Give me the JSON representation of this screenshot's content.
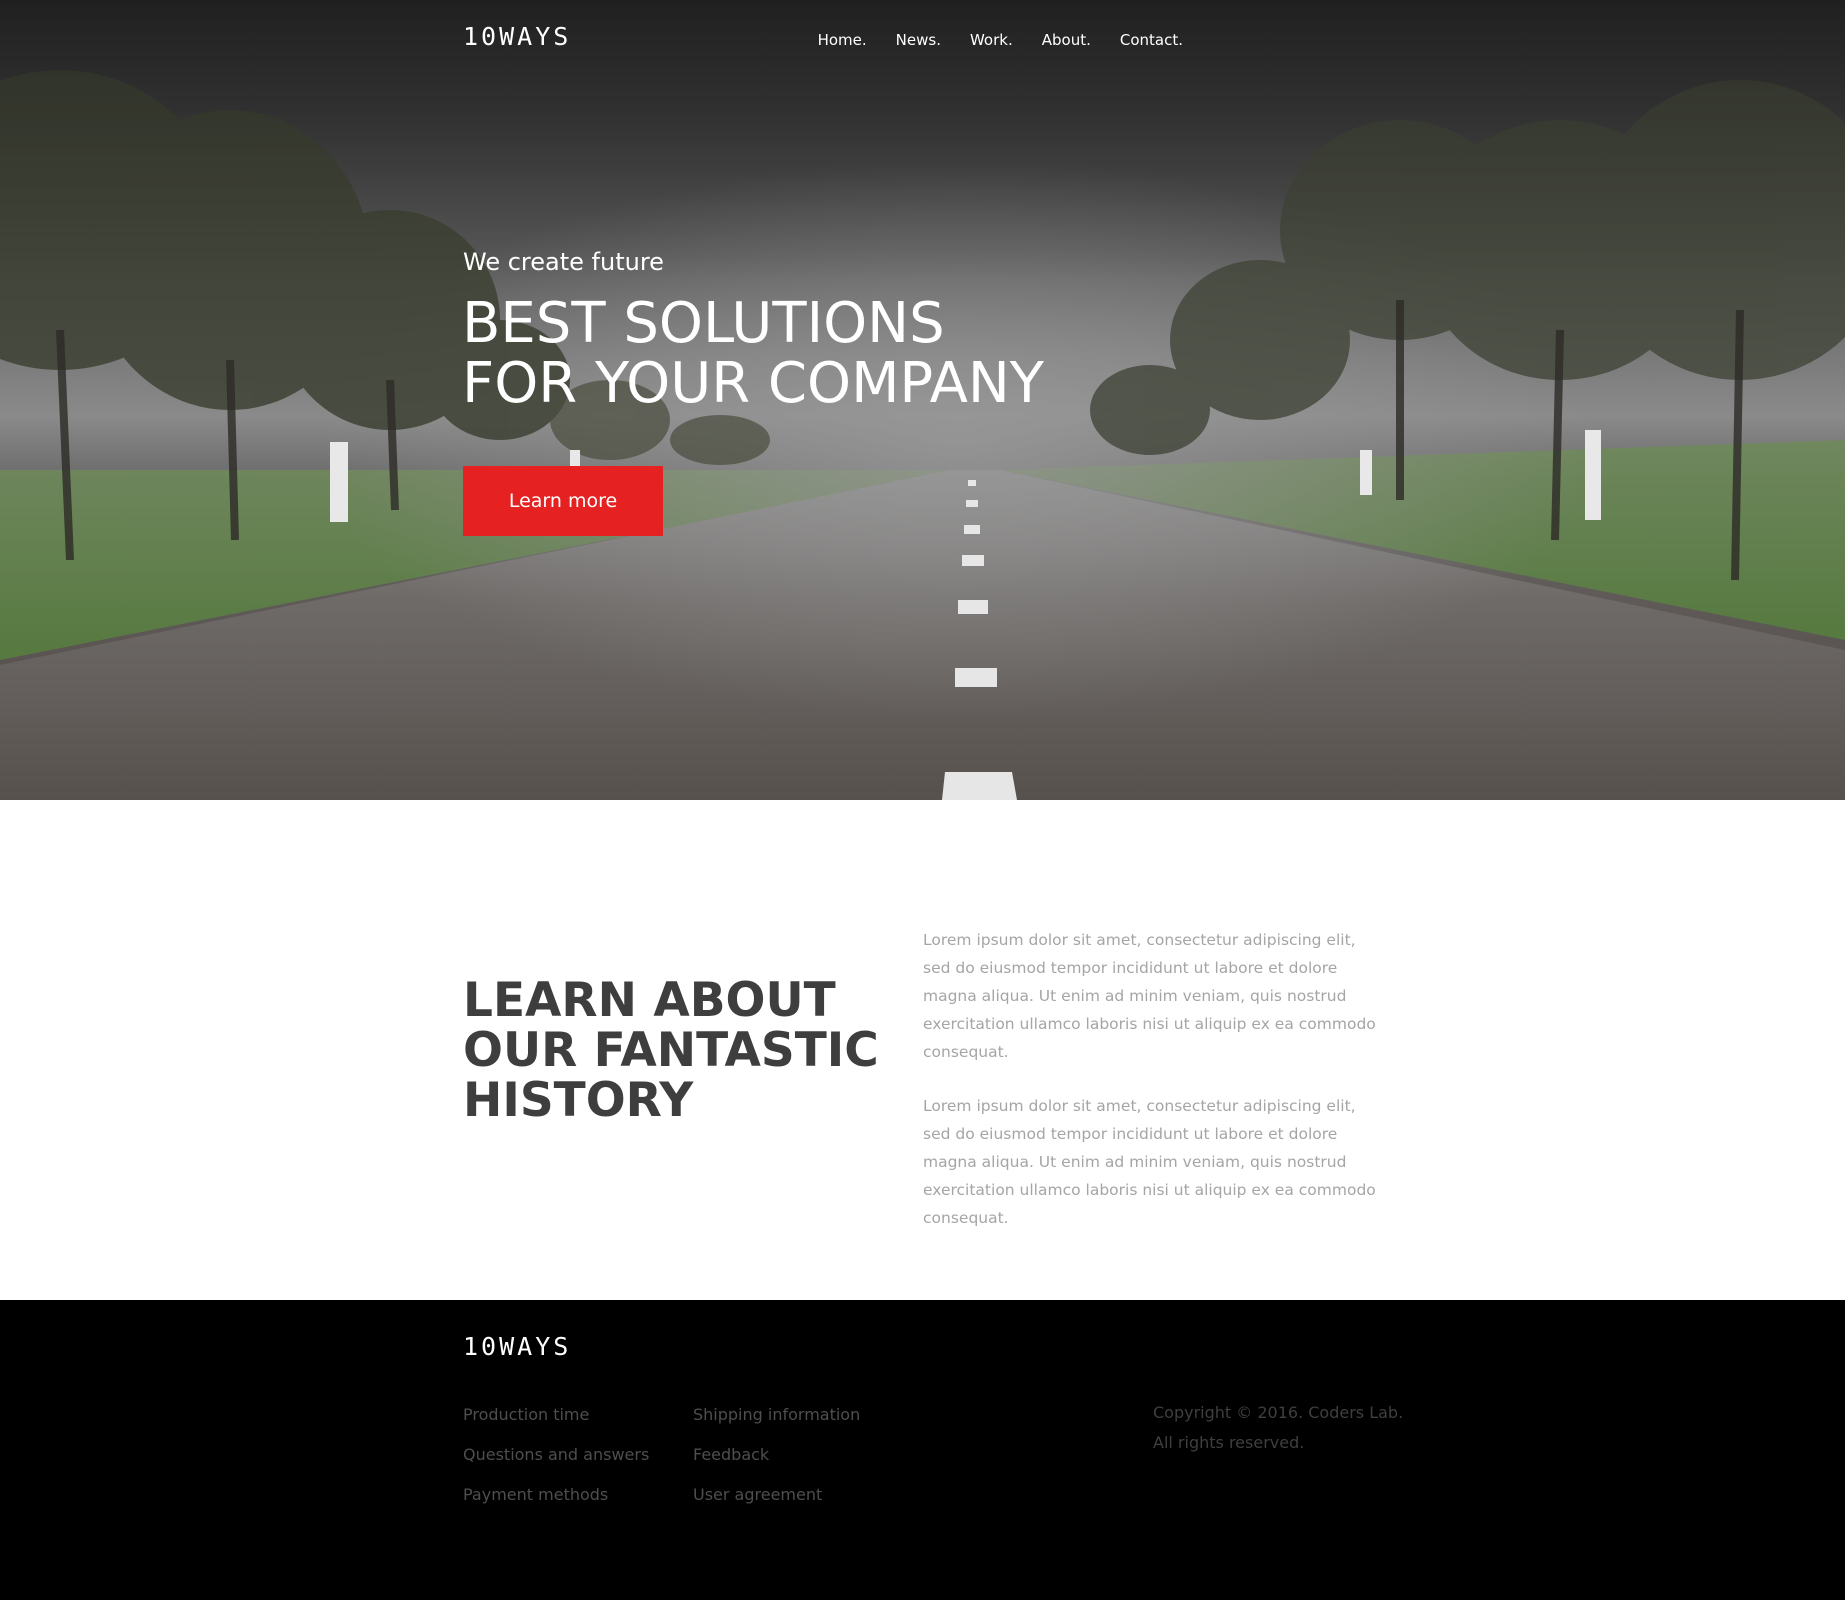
{
  "brand": {
    "logo": "10WAYS"
  },
  "nav": {
    "items": [
      {
        "label": "Home."
      },
      {
        "label": "News."
      },
      {
        "label": "Work."
      },
      {
        "label": "About."
      },
      {
        "label": "Contact."
      }
    ]
  },
  "hero": {
    "subtitle": "We create future",
    "title_line1": "BEST SOLUTIONS",
    "title_line2": "FOR YOUR COMPANY",
    "button_label": "Learn more",
    "button_color": "#e52121"
  },
  "about": {
    "title_line1": "LEARN ABOUT",
    "title_line2": "OUR FANTASTIC",
    "title_line3": "HISTORY",
    "paragraphs": [
      "Lorem ipsum dolor sit amet, consectetur adipiscing elit, sed do eiusmod tempor incididunt ut labore et dolore magna aliqua. Ut enim ad minim veniam, quis nostrud exercitation ullamco laboris nisi ut aliquip ex ea commodo consequat.",
      "Lorem ipsum dolor sit amet, consectetur adipiscing elit, sed do eiusmod tempor incididunt ut labore et dolore magna aliqua. Ut enim ad minim veniam, quis nostrud exercitation ullamco laboris nisi ut aliquip ex ea commodo consequat."
    ]
  },
  "footer": {
    "logo": "10WAYS",
    "col1": [
      "Production time",
      "Questions and answers",
      "Payment methods"
    ],
    "col2": [
      "Shipping information",
      "Feedback",
      "User agreement"
    ],
    "copyright_line1": "Copyright © 2016. Coders Lab.",
    "copyright_line2": "All rights reserved."
  },
  "colors": {
    "accent": "#e52121",
    "footer_bg": "#000000",
    "heading": "#3e3e3e",
    "body_text": "#a5a5a5"
  }
}
